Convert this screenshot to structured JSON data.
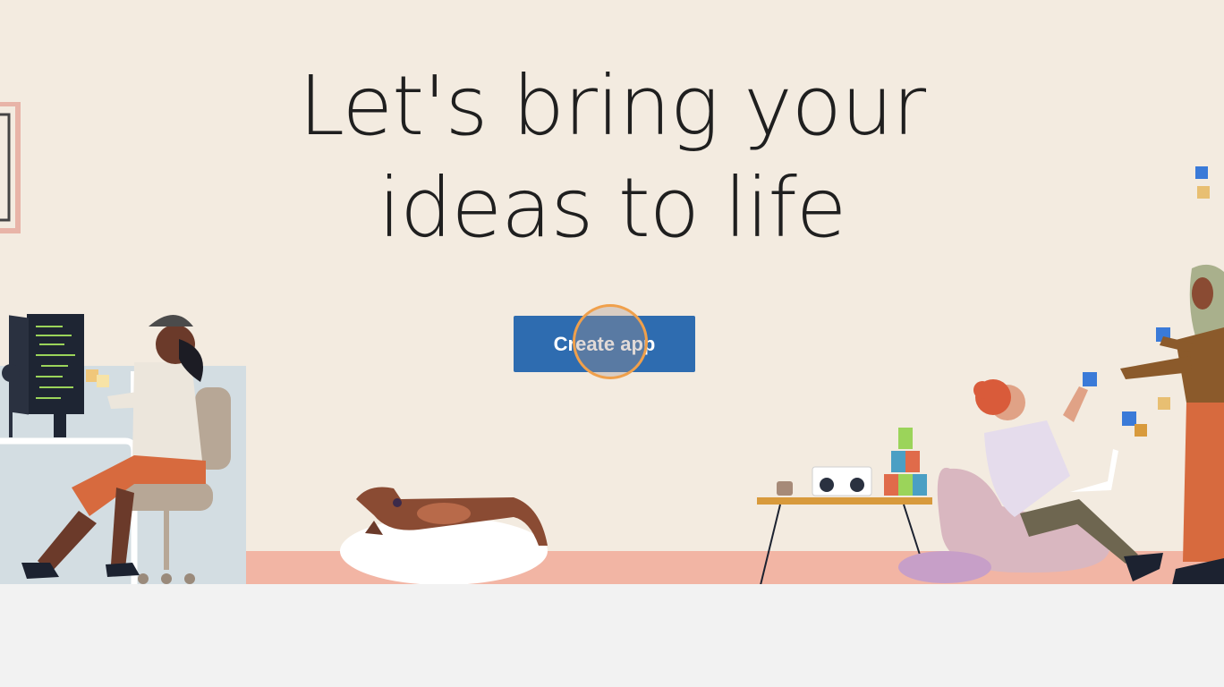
{
  "hero": {
    "headline_line1": "Let's bring your",
    "headline_line2": "ideas to life",
    "cta_label": "Create app"
  },
  "colors": {
    "background": "#f3ebe0",
    "button": "#2e6cb0",
    "floor": "#f2b5a4",
    "click_ring": "#f0a04b"
  },
  "icons": [
    "developer-illustration",
    "dog-illustration",
    "side-table-illustration",
    "beanbag-person-illustration",
    "standing-person-illustration"
  ]
}
